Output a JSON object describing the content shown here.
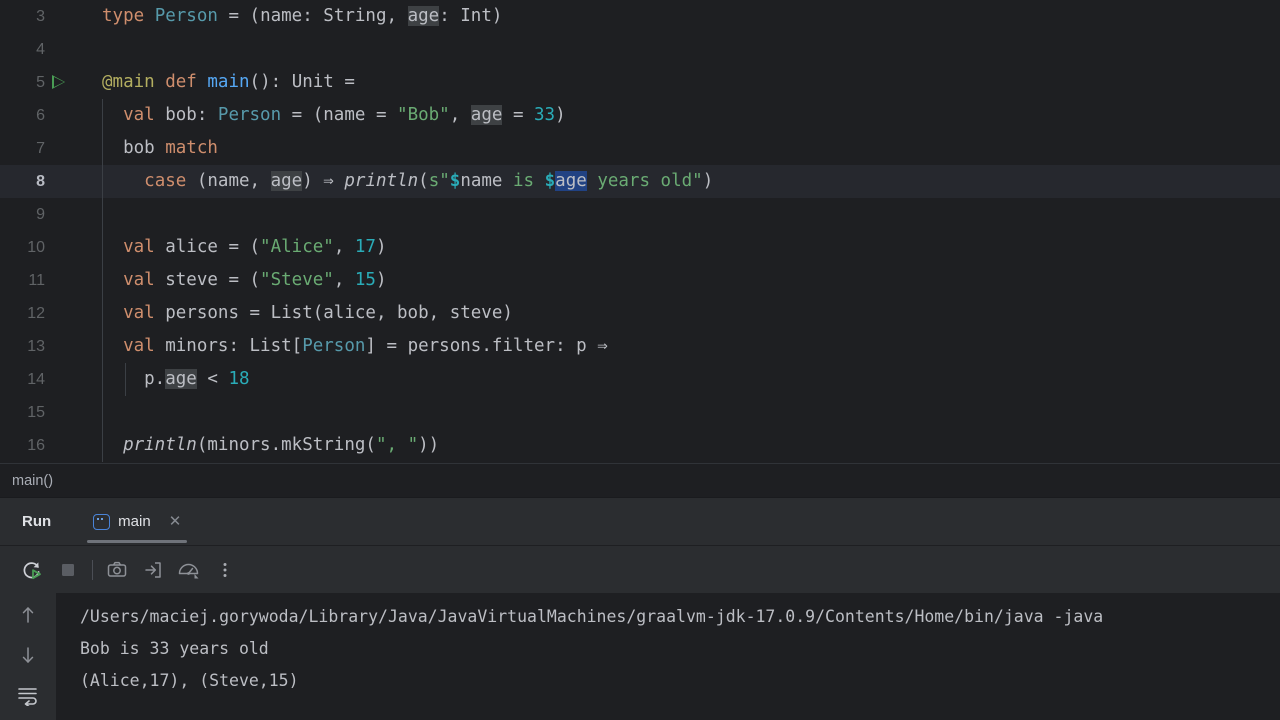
{
  "editor": {
    "first_visible_line": 3,
    "current_line": 8,
    "breadcrumb": "main()",
    "lines": [
      {
        "num": "3",
        "text": "type Person = (name: String, age: Int)"
      },
      {
        "num": "4",
        "text": ""
      },
      {
        "num": "5",
        "text": "@main def main(): Unit ="
      },
      {
        "num": "6",
        "text": "  val bob: Person = (name = \"Bob\", age = 33)"
      },
      {
        "num": "7",
        "text": "  bob match"
      },
      {
        "num": "8",
        "text": "    case (name, age) ⇒ println(s\"$name is $age years old\")"
      },
      {
        "num": "9",
        "text": ""
      },
      {
        "num": "10",
        "text": "  val alice = (\"Alice\", 17)"
      },
      {
        "num": "11",
        "text": "  val steve = (\"Steve\", 15)"
      },
      {
        "num": "12",
        "text": "  val persons = List(alice, bob, steve)"
      },
      {
        "num": "13",
        "text": "  val minors: List[Person] = persons.filter: p ⇒"
      },
      {
        "num": "14",
        "text": "    p.age < 18"
      },
      {
        "num": "15",
        "text": ""
      },
      {
        "num": "16",
        "text": "  println(minors.mkString(\", \"))"
      }
    ],
    "gutter": {
      "run_marker_line": "5",
      "run_marker_icon": "run-triangle-icon",
      "lightbulb_line": "7",
      "lightbulb_icon": "lightbulb-icon"
    },
    "selection": "$age",
    "highlighted_identifier": "age",
    "colors": {
      "background": "#1e1f22",
      "current_line": "#26282e",
      "keyword": "#cf8e6d",
      "type": "#579aab",
      "string": "#6aab73",
      "number": "#2aacb8",
      "function": "#56a8f5",
      "annotation": "#b3ae60",
      "plain": "#bcbec4",
      "selection": "#214283",
      "identifier_highlight": "#3e4144",
      "run_marker": "#499c54"
    }
  },
  "run_panel": {
    "title": "Run",
    "tab": {
      "label": "main",
      "icon": "run-configuration-icon",
      "close_label": "✕",
      "active": true
    },
    "toolbar": [
      {
        "name": "rerun-button",
        "icon": "rerun-icon",
        "label": "Rerun"
      },
      {
        "name": "stop-button",
        "icon": "stop-icon",
        "label": "Stop"
      },
      {
        "name": "screenshot-button",
        "icon": "camera-icon",
        "label": "Screenshot"
      },
      {
        "name": "thread-dump-button",
        "icon": "arrow-into-box-icon",
        "label": "Dump Threads"
      },
      {
        "name": "profiler-button",
        "icon": "gauge-icon",
        "label": "Profiler"
      },
      {
        "name": "more-options-button",
        "icon": "vertical-dots-icon",
        "label": "More"
      }
    ],
    "console_side_buttons": [
      {
        "name": "scroll-up-button",
        "icon": "arrow-up-icon",
        "label": "Up"
      },
      {
        "name": "scroll-down-button",
        "icon": "arrow-down-icon",
        "label": "Down"
      },
      {
        "name": "soft-wrap-button",
        "icon": "soft-wrap-icon",
        "label": "Soft-Wrap"
      }
    ],
    "console_output": [
      "/Users/maciej.gorywoda/Library/Java/JavaVirtualMachines/graalvm-jdk-17.0.9/Contents/Home/bin/java -java",
      "Bob is 33 years old",
      "(Alice,17), (Steve,15)"
    ]
  }
}
